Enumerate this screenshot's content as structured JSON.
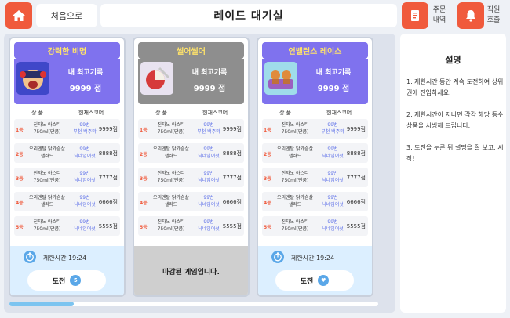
{
  "header": {
    "home_label": "처음으로",
    "title": "레이드 대기실",
    "order_label_1": "주문",
    "order_label_2": "내역",
    "call_label_1": "직원",
    "call_label_2": "호출"
  },
  "record_label": "내 최고기록",
  "col_prize": "상 품",
  "col_score": "현재스코어",
  "cards": [
    {
      "title": "강력한 비명",
      "best": "9999 점",
      "status": "active",
      "rows": [
        {
          "rank": "1등",
          "prize_1": "진자노 아스티",
          "prize_2": "750ml(단품)",
          "coupon_1": "99번",
          "coupon_2": "부천 백주막",
          "score": "9999점"
        },
        {
          "rank": "2등",
          "prize_1": "오리엔탈 닭가슴살",
          "prize_2": "샐러드",
          "coupon_1": "99번",
          "coupon_2": "닉네임여섯",
          "score": "8888점"
        },
        {
          "rank": "3등",
          "prize_1": "진자노 아스티",
          "prize_2": "750ml(단품)",
          "coupon_1": "99번",
          "coupon_2": "닉네임여섯",
          "score": "7777점"
        },
        {
          "rank": "4등",
          "prize_1": "오리엔탈 닭가슴살",
          "prize_2": "샐러드",
          "coupon_1": "99번",
          "coupon_2": "닉네임여섯",
          "score": "6666점"
        },
        {
          "rank": "5등",
          "prize_1": "진자노 아스티",
          "prize_2": "750ml(단품)",
          "coupon_1": "99번",
          "coupon_2": "닉네임여섯",
          "score": "5555점"
        }
      ],
      "timer": "제한시간  19:24",
      "button": "도전",
      "badge": "5"
    },
    {
      "title": "썰어썰어",
      "best": "9999 점",
      "status": "closed",
      "rows": [
        {
          "rank": "1등",
          "prize_1": "진자노 아스티",
          "prize_2": "750ml(단품)",
          "coupon_1": "99번",
          "coupon_2": "부천 백주막",
          "score": "9999점"
        },
        {
          "rank": "2등",
          "prize_1": "오리엔탈 닭가슴살",
          "prize_2": "샐러드",
          "coupon_1": "99번",
          "coupon_2": "닉네임여섯",
          "score": "8888점"
        },
        {
          "rank": "3등",
          "prize_1": "진자노 아스티",
          "prize_2": "750ml(단품)",
          "coupon_1": "99번",
          "coupon_2": "닉네임여섯",
          "score": "7777점"
        },
        {
          "rank": "4등",
          "prize_1": "오리엔탈 닭가슴살",
          "prize_2": "샐러드",
          "coupon_1": "99번",
          "coupon_2": "닉네임여섯",
          "score": "6666점"
        },
        {
          "rank": "5등",
          "prize_1": "진자노 아스티",
          "prize_2": "750ml(단품)",
          "coupon_1": "99번",
          "coupon_2": "닉네임여섯",
          "score": "5555점"
        }
      ],
      "closed_text": "마감된 게임입니다."
    },
    {
      "title": "언밸런스 레이스",
      "best": "9999 점",
      "status": "active",
      "rows": [
        {
          "rank": "1등",
          "prize_1": "진자노 아스티",
          "prize_2": "750ml(단품)",
          "coupon_1": "99번",
          "coupon_2": "부천 백주막",
          "score": "9999점"
        },
        {
          "rank": "2등",
          "prize_1": "오리엔탈 닭가슴살",
          "prize_2": "샐러드",
          "coupon_1": "99번",
          "coupon_2": "닉네임여섯",
          "score": "8888점"
        },
        {
          "rank": "3등",
          "prize_1": "진자노 아스티",
          "prize_2": "750ml(단품)",
          "coupon_1": "99번",
          "coupon_2": "닉네임여섯",
          "score": "7777점"
        },
        {
          "rank": "4등",
          "prize_1": "오리엔탈 닭가슴살",
          "prize_2": "샐러드",
          "coupon_1": "99번",
          "coupon_2": "닉네임여섯",
          "score": "6666점"
        },
        {
          "rank": "5등",
          "prize_1": "진자노 아스티",
          "prize_2": "750ml(단품)",
          "coupon_1": "99번",
          "coupon_2": "닉네임여섯",
          "score": "5555점"
        }
      ],
      "timer": "제한시간  19:24",
      "button": "도전",
      "badge": "♥"
    }
  ],
  "info": {
    "title": "설명",
    "items": [
      "1. 제한시간 동안 계속 도전하여 상위권에 진입하세요.",
      "2. 제한시간이 지나면 각각 해당 등수 상품을 서빙해 드립니다.",
      "3. 도전을 누른 뒤 설명을 잘 보고, 시작!"
    ]
  },
  "colors": {
    "accent": "#f05a3c",
    "card_active": "#7f72ee",
    "card_closed": "#8e8e8e",
    "title_text": "#ffe36a",
    "timer_bg": "#dcefff"
  },
  "scroll_fraction": 0.17
}
